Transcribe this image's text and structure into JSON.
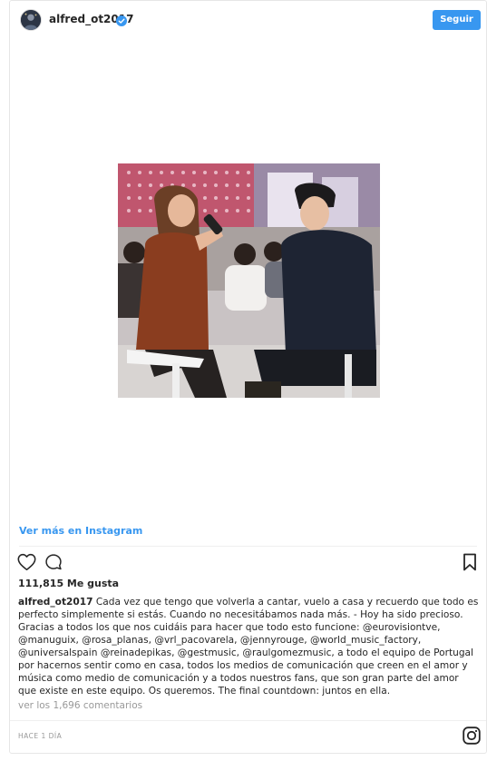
{
  "header": {
    "username": "alfred_ot2017",
    "follow_label": "Seguir"
  },
  "media": {
    "view_more_label": "Ver más en Instagram"
  },
  "stats": {
    "likes_text": "111,815 Me gusta"
  },
  "caption": {
    "username": "alfred_ot2017",
    "text": "Cada vez que tengo que volverla a cantar, vuelo a casa y recuerdo que todo es perfecto simplemente si estás. Cuando no necesitábamos nada más. - Hoy ha sido precioso. Gracias a todos los que nos cuidáis para hacer que todo esto funcione: @eurovisiontve, @manuguix, @rosa_planas, @vrl_pacovarela, @jennyrouge, @world_music_factory, @universalspain @reinadepikas, @gestmusic, @raulgomezmusic, a todo el equipo de Portugal por hacernos sentir como en casa, todos los medios de comunicación que creen en el amor y música como medio de comunicación y a todos nuestros fans, que son gran parte del amor que existe en este equipo. Os queremos. The final countdown: juntos en ella."
  },
  "comments": {
    "link_text": "ver los 1,696 comentarios"
  },
  "footer": {
    "timestamp": "HACE 1 DÍA"
  },
  "icons": {
    "verified": "verified-badge-icon",
    "like": "heart-icon",
    "comment": "comment-icon",
    "save": "bookmark-icon",
    "brand": "instagram-logo-icon"
  },
  "colors": {
    "accent": "#3897f0",
    "text": "#262626",
    "muted": "#999999",
    "border": "#e6e6e6"
  }
}
